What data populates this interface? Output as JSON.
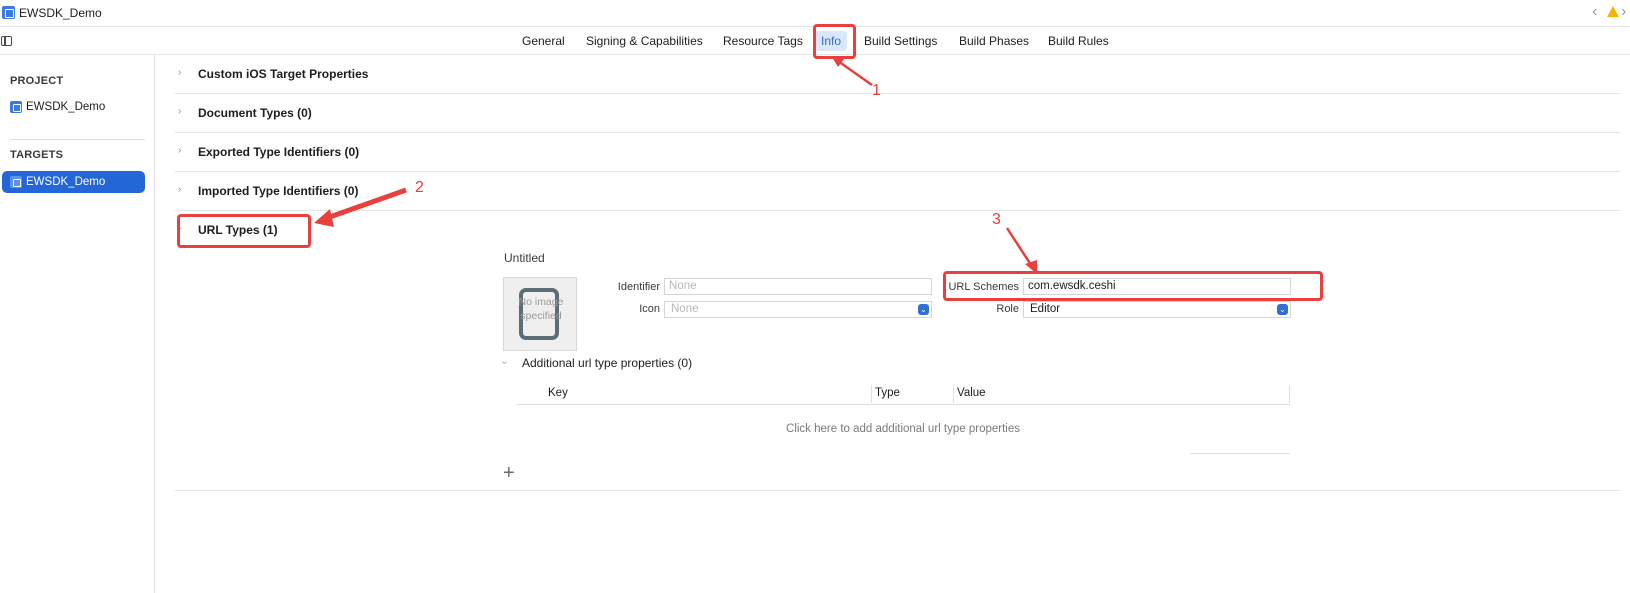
{
  "window": {
    "title": "EWSDK_Demo"
  },
  "tabs": [
    "General",
    "Signing & Capabilities",
    "Resource Tags",
    "Info",
    "Build Settings",
    "Build Phases",
    "Build Rules"
  ],
  "active_tab": "Info",
  "sidebar": {
    "project_header": "PROJECT",
    "project_item": "EWSDK_Demo",
    "targets_header": "TARGETS",
    "target_item": "EWSDK_Demo"
  },
  "sections": [
    {
      "label": "Custom iOS Target Properties",
      "expanded": false
    },
    {
      "label": "Document Types (0)",
      "expanded": false
    },
    {
      "label": "Exported Type Identifiers (0)",
      "expanded": false
    },
    {
      "label": "Imported Type Identifiers (0)",
      "expanded": false
    },
    {
      "label": "URL Types (1)",
      "expanded": true
    }
  ],
  "url_type": {
    "name": "Untitled",
    "image_placeholder": "No image specified",
    "identifier_label": "Identifier",
    "identifier_placeholder": "None",
    "icon_label": "Icon",
    "icon_placeholder": "None",
    "url_schemes_label": "URL Schemes",
    "url_schemes_value": "com.ewsdk.ceshi",
    "role_label": "Role",
    "role_value": "Editor",
    "additional_props_label": "Additional url type properties (0)",
    "table_columns": [
      "Key",
      "Type",
      "Value"
    ],
    "empty_table_text": "Click here to add additional url type properties"
  },
  "annotations": [
    "1",
    "2",
    "3"
  ],
  "colors": {
    "annotation_red": "#e8403d",
    "accent_blue": "#2466d8",
    "warning": "#f5b400"
  }
}
